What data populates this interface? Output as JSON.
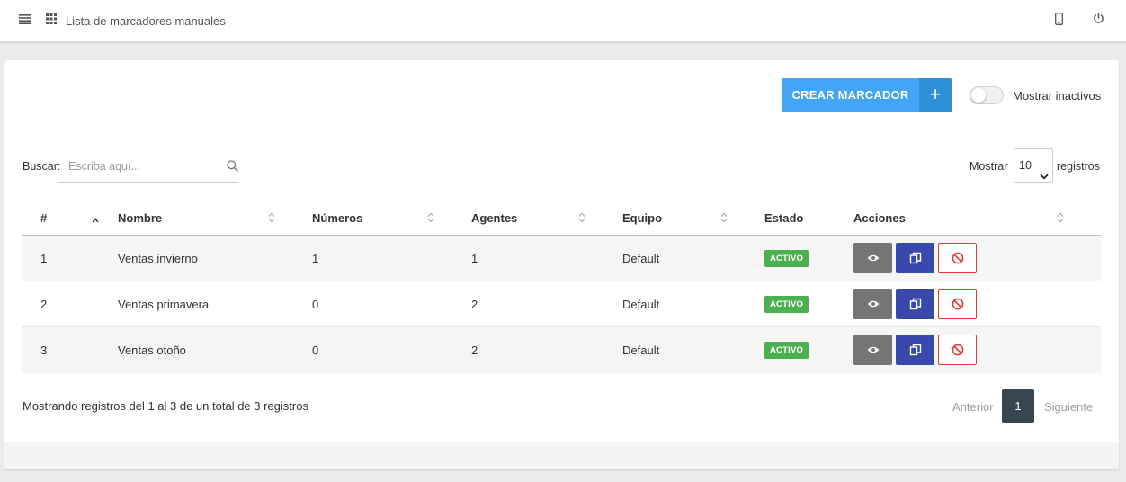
{
  "header": {
    "title": "Lista de marcadores manuales",
    "icons": [
      "menu-icon",
      "apps-grid-icon",
      "phone-icon",
      "power-icon"
    ]
  },
  "toolbar": {
    "create_label": "CREAR MARCADOR",
    "create_plus": "+",
    "toggle_label": "Mostrar inactivos",
    "toggle_on": false
  },
  "search": {
    "label": "Buscar:",
    "placeholder": "Escriba aquí..."
  },
  "length": {
    "prefix": "Mostrar",
    "value": "10",
    "suffix": "registros"
  },
  "table": {
    "columns": [
      "#",
      "Nombre",
      "Números",
      "Agentes",
      "Equipo",
      "Estado",
      "Acciones"
    ],
    "rows": [
      {
        "id": "1",
        "nombre": "Ventas invierno",
        "numeros": "1",
        "agentes": "1",
        "equipo": "Default",
        "estado": "ACTIVO"
      },
      {
        "id": "2",
        "nombre": "Ventas primavera",
        "numeros": "0",
        "agentes": "2",
        "equipo": "Default",
        "estado": "ACTIVO"
      },
      {
        "id": "3",
        "nombre": "Ventas otoño",
        "numeros": "0",
        "agentes": "2",
        "equipo": "Default",
        "estado": "ACTIVO"
      }
    ]
  },
  "footer": {
    "info": "Mostrando registros del 1 al 3 de un total de 3 registros",
    "prev": "Anterior",
    "current": "1",
    "next": "Siguiente"
  },
  "colors": {
    "primary": "#42a5f5",
    "badge": "#4caf50",
    "view": "#757575",
    "copy": "#3949ab",
    "danger": "#e53935",
    "page_active": "#37474f"
  }
}
